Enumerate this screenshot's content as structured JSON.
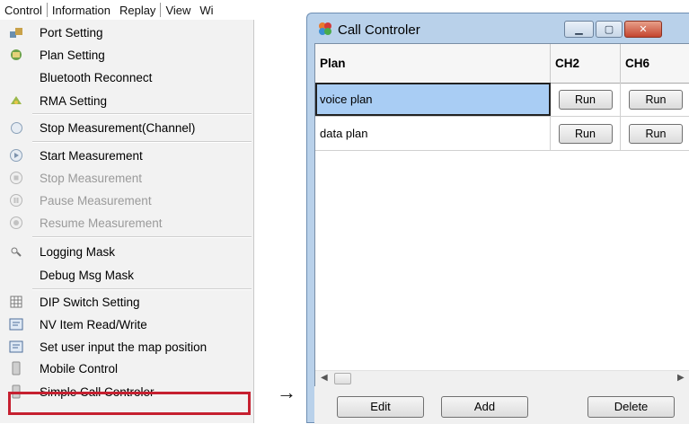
{
  "menubar": {
    "items": [
      "Control",
      "Information",
      "Replay",
      "View",
      "Wi"
    ]
  },
  "menu": {
    "items": [
      {
        "label": "Port Setting",
        "icon": "port-icon",
        "disabled": false
      },
      {
        "label": "Plan Setting",
        "icon": "plan-icon",
        "disabled": false
      },
      {
        "label": "Bluetooth Reconnect",
        "icon": "",
        "disabled": false
      },
      {
        "label": "RMA Setting",
        "icon": "rma-icon",
        "disabled": false
      },
      {
        "label": "Stop Measurement(Channel)",
        "icon": "stop-circle-icon",
        "disabled": false
      },
      {
        "label": "Start Measurement",
        "icon": "play-circle-icon",
        "disabled": false
      },
      {
        "label": "Stop Measurement",
        "icon": "stop-circle-icon",
        "disabled": true
      },
      {
        "label": "Pause Measurement",
        "icon": "pause-circle-icon",
        "disabled": true
      },
      {
        "label": "Resume Measurement",
        "icon": "record-circle-icon",
        "disabled": true
      },
      {
        "label": "Logging Mask",
        "icon": "mask-icon",
        "disabled": false
      },
      {
        "label": "Debug Msg Mask",
        "icon": "",
        "disabled": false
      },
      {
        "label": "DIP Switch Setting",
        "icon": "grid-icon",
        "disabled": false
      },
      {
        "label": "NV Item Read/Write",
        "icon": "nv-icon",
        "disabled": false
      },
      {
        "label": "Set user input the map position",
        "icon": "map-icon",
        "disabled": false
      },
      {
        "label": "Mobile Control",
        "icon": "mobile-icon",
        "disabled": false
      },
      {
        "label": "Simple Call Controler",
        "icon": "call-icon",
        "disabled": false
      }
    ],
    "highlight_color": "#c62030"
  },
  "arrow": "→",
  "window": {
    "title": "Call Controler",
    "columns": [
      "Plan",
      "CH2",
      "CH6"
    ],
    "rows": [
      {
        "plan": "voice plan",
        "ch2": "Run",
        "ch6": "Run",
        "selected": true
      },
      {
        "plan": "data plan",
        "ch2": "Run",
        "ch6": "Run",
        "selected": false
      }
    ],
    "buttons": {
      "edit": "Edit",
      "add": "Add",
      "delete": "Delete"
    }
  }
}
